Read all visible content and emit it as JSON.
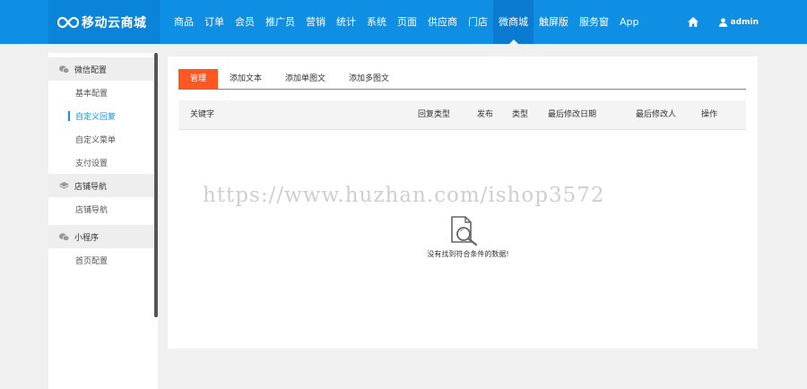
{
  "brand": {
    "name": "移动云商城"
  },
  "nav": {
    "items": [
      "商品",
      "订单",
      "会员",
      "推广员",
      "营销",
      "统计",
      "系统",
      "页面",
      "供应商",
      "门店",
      "微商城",
      "触屏版",
      "服务窗",
      "App"
    ],
    "active_index": 10
  },
  "user": {
    "name": "admin"
  },
  "sidebar": {
    "groups": [
      {
        "title": "微信配置",
        "icon": "wechat-icon",
        "items": [
          "基本配置",
          "自定义回复",
          "自定义菜单",
          "支付设置"
        ]
      },
      {
        "title": "店铺导航",
        "icon": "layers-icon",
        "items": [
          "店铺导航"
        ]
      },
      {
        "title": "小程序",
        "icon": "wechat-icon",
        "items": [
          "首页配置"
        ]
      }
    ],
    "active_item": "自定义回复"
  },
  "tabs": [
    "管理",
    "添加文本",
    "添加单图文",
    "添加多图文"
  ],
  "table": {
    "columns": [
      "关键字",
      "回复类型",
      "发布",
      "类型",
      "最后修改日期",
      "最后修改人",
      "操作"
    ]
  },
  "empty_state": {
    "text": "没有找到符合条件的数据!",
    "icon": "search-document-icon"
  },
  "watermark": "https://www.huzhan.com/ishop3572",
  "colors": {
    "topbar": "#0f8fe3",
    "accent": "#ff5722",
    "active_link": "#1a8ed8"
  }
}
